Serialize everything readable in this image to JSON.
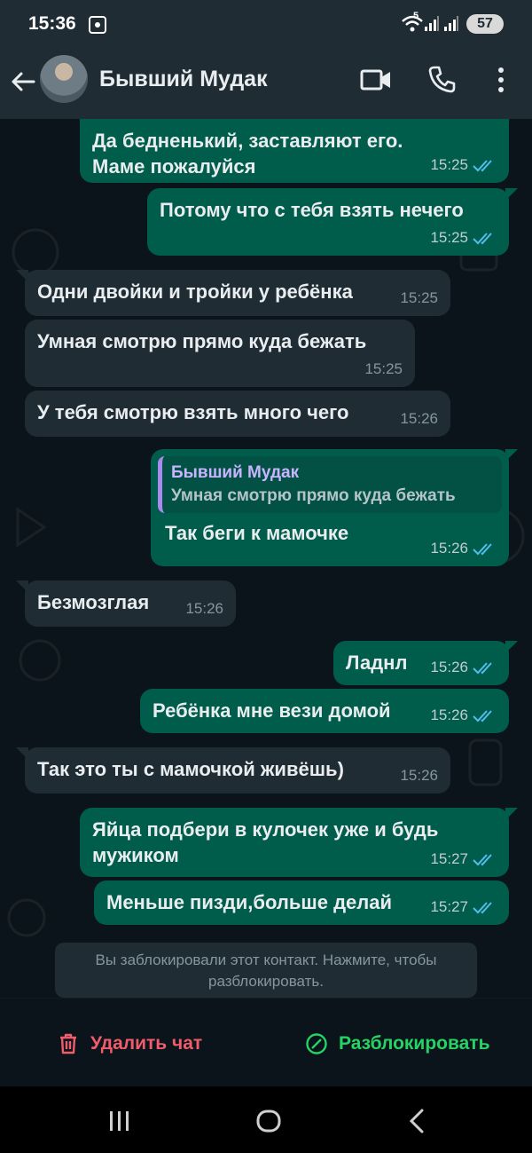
{
  "status": {
    "time": "15:36",
    "network": "5",
    "battery": "57"
  },
  "header": {
    "contact_name": "Бывший Мудак"
  },
  "messages": [
    {
      "dir": "out",
      "text": "Да бедненький, заставляют его. Маме пожалуйся",
      "time": "15:25"
    },
    {
      "dir": "out",
      "text": "Потому что с тебя взять нечего",
      "time": "15:25"
    },
    {
      "dir": "in",
      "text": "Одни двойки и тройки у ребёнка",
      "time": "15:25"
    },
    {
      "dir": "in",
      "text": "Умная смотрю прямо куда бежать",
      "time": "15:25"
    },
    {
      "dir": "in",
      "text": "У тебя смотрю взять много чего",
      "time": "15:26"
    },
    {
      "dir": "out",
      "quote_name": "Бывший Мудак",
      "quote_text": "Умная смотрю прямо куда бежать",
      "text": "Так беги к мамочке",
      "time": "15:26"
    },
    {
      "dir": "in",
      "text": "Безмозглая",
      "time": "15:26"
    },
    {
      "dir": "out",
      "text": "Ладнл",
      "time": "15:26"
    },
    {
      "dir": "out",
      "text": "Ребёнка мне вези домой",
      "time": "15:26"
    },
    {
      "dir": "in",
      "text": "Так это ты с мамочкой живёшь)",
      "time": "15:26"
    },
    {
      "dir": "out",
      "text": "Яйца подбери в кулочек уже и будь мужиком",
      "time": "15:27"
    },
    {
      "dir": "out",
      "text": "Меньше пизди,больше делай",
      "time": "15:27"
    }
  ],
  "blocked_notice": "Вы заблокировали этот контакт. Нажмите, чтобы разблокировать.",
  "actions": {
    "delete_label": "Удалить чат",
    "unblock_label": "Разблокировать"
  },
  "colors": {
    "outgoing": "#005c4b",
    "incoming": "#1f2c34",
    "delete": "#f15c6d",
    "unblock": "#25d366",
    "read_ticks": "#53bdeb"
  }
}
